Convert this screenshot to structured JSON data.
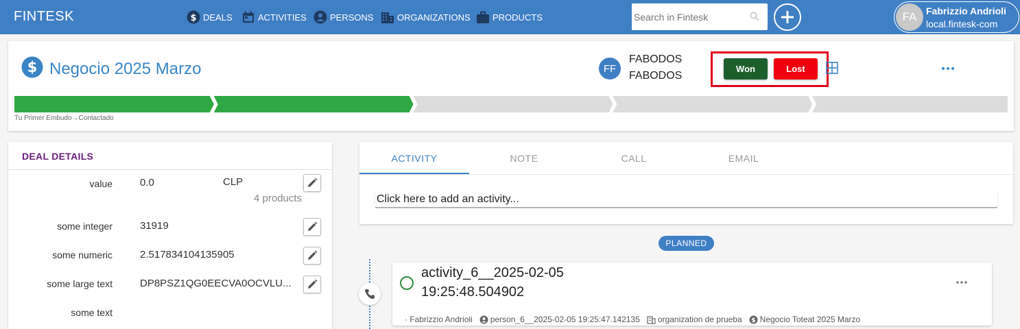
{
  "app": {
    "brand": "FINTESK"
  },
  "nav": [
    {
      "label": "DEALS",
      "icon": "dollar-icon"
    },
    {
      "label": "ACTIVITIES",
      "icon": "calendar-icon"
    },
    {
      "label": "PERSONS",
      "icon": "person-icon"
    },
    {
      "label": "ORGANIZATIONS",
      "icon": "building-icon"
    },
    {
      "label": "PRODUCTS",
      "icon": "briefcase-icon"
    }
  ],
  "search": {
    "placeholder": "Search in Fintesk"
  },
  "user": {
    "initials": "FA",
    "name": "Fabrizzio Andrioli",
    "host": "local.fintesk-com"
  },
  "deal": {
    "title": "Negocio 2025 Marzo",
    "owner_initials": "FF",
    "owner_line1": "FABODOS",
    "owner_line2": "FABODOS",
    "won_label": "Won",
    "lost_label": "Lost",
    "stage_caption": "Tu Primer Embudo→Contactado",
    "stages_total": 5,
    "stages_completed": 2,
    "colors": {
      "completed": "#2ea842",
      "pending": "#dcdcdc",
      "won": "#1d5f2c",
      "lost": "#f0000f",
      "highlight": "#e0001b"
    }
  },
  "details": {
    "title": "DEAL DETAILS",
    "fields": [
      {
        "label": "value",
        "value": "0.0",
        "currency": "CLP",
        "products": "4 products"
      },
      {
        "label": "some integer",
        "value": "31919"
      },
      {
        "label": "some numeric",
        "value": "2.517834104135905"
      },
      {
        "label": "some large text",
        "value": "DP8PSZ1QG0EECVA0OCVLU..."
      },
      {
        "label": "some text",
        "value": ""
      }
    ]
  },
  "activity_panel": {
    "tabs": [
      "ACTIVITY",
      "NOTE",
      "CALL",
      "EMAIL"
    ],
    "active_tab": "ACTIVITY",
    "add_placeholder": "Click here to add an activity...",
    "planned_label": "PLANNED"
  },
  "activity_item": {
    "title_line1": "activity_6__2025-02-05",
    "title_line2": "19:25:48.504902",
    "type_icon": "phone-icon",
    "owner": "· Fabrizzio Andrioli",
    "person": "person_6__2025-02-05 19:25:47.142135",
    "organization": "organization de prueba",
    "deal": "Negocio Toteat 2025 Marzo"
  }
}
